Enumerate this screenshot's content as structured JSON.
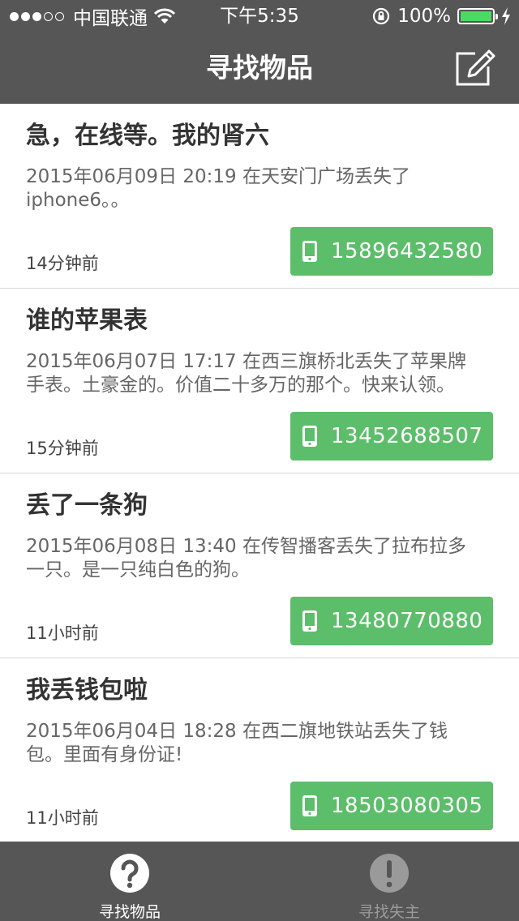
{
  "status_bar": {
    "carrier": "中国联通",
    "time": "下午5:35",
    "battery": "100%",
    "battery_level": 1.0,
    "signal_bars_filled": 3,
    "signal_bars_total": 5
  },
  "nav": {
    "title": "寻找物品",
    "compose_icon": "compose-icon"
  },
  "items": [
    {
      "title": "急，在线等。我的肾六",
      "description": "2015年06月09日 20:19 在天安门广场丢失了iphone6。。",
      "time_ago": "14分钟前",
      "phone": "15896432580"
    },
    {
      "title": "谁的苹果表",
      "description": "2015年06月07日 17:17 在西三旗桥北丢失了苹果牌手表。土豪金的。价值二十多万的那个。快来认领。",
      "time_ago": "15分钟前",
      "phone": "13452688507"
    },
    {
      "title": "丢了一条狗",
      "description": "2015年06月08日 13:40 在传智播客丢失了拉布拉多一只。是一只纯白色的狗。",
      "time_ago": "11小时前",
      "phone": "13480770880"
    },
    {
      "title": "我丢钱包啦",
      "description": "2015年06月04日 18:28 在西二旗地铁站丢失了钱包。里面有身份证!",
      "time_ago": "11小时前",
      "phone": "18503080305"
    }
  ],
  "tabs": [
    {
      "label": "寻找物品",
      "icon": "question-icon",
      "active": true
    },
    {
      "label": "寻找失主",
      "icon": "exclamation-icon",
      "active": false
    }
  ],
  "colors": {
    "bar_background": "#565656",
    "accent_green": "#5cbe6a",
    "battery_green": "#4cd964"
  }
}
